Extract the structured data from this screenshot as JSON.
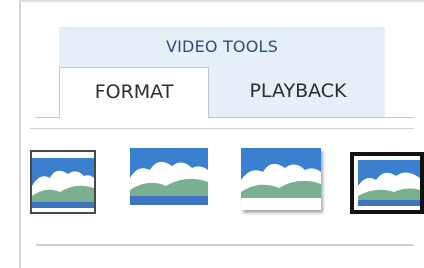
{
  "contextual_tab_group": {
    "title": "VIDEO TOOLS"
  },
  "tabs": [
    {
      "label": "FORMAT",
      "selected": true
    },
    {
      "label": "PLAYBACK",
      "selected": false
    }
  ],
  "video_styles": [
    {
      "icon": "video-style-framed-icon"
    },
    {
      "icon": "video-style-plain-icon"
    },
    {
      "icon": "video-style-shadow-icon"
    },
    {
      "icon": "video-style-thick-frame-icon"
    }
  ],
  "colors": {
    "context_header_bg": "#e6eef8",
    "context_title": "#2e4e7a",
    "sky": "#3b7fcf",
    "cloud": "#ffffff",
    "hill": "#7ab08f",
    "base": "#3d74c2"
  }
}
